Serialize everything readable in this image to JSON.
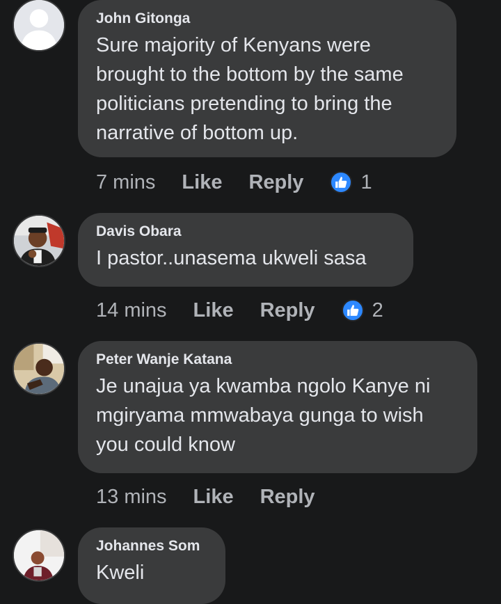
{
  "comments": [
    {
      "author": "John Gitonga",
      "text": "Sure majority of Kenyans were brought to the bottom by the same politicians pretending to bring the narrative of bottom up.",
      "time": "7 mins",
      "like_label": "Like",
      "reply_label": "Reply",
      "reactions": "1"
    },
    {
      "author": "Davis Obara",
      "text": "I pastor..unasema ukweli sasa",
      "time": "14 mins",
      "like_label": "Like",
      "reply_label": "Reply",
      "reactions": "2"
    },
    {
      "author": "Peter Wanje Katana",
      "text": "Je unajua ya kwamba ngolo Kanye ni mgiryama mmwabaya gunga to wish you could know",
      "time": "13 mins",
      "like_label": "Like",
      "reply_label": "Reply"
    },
    {
      "author": "Johannes Som",
      "text": "Kweli"
    }
  ],
  "colors": {
    "background": "#18191a",
    "bubble": "#3a3b3c",
    "primary_text": "#e4e6eb",
    "secondary_text": "#b0b3b8",
    "like_blue": "#2d88ff"
  }
}
